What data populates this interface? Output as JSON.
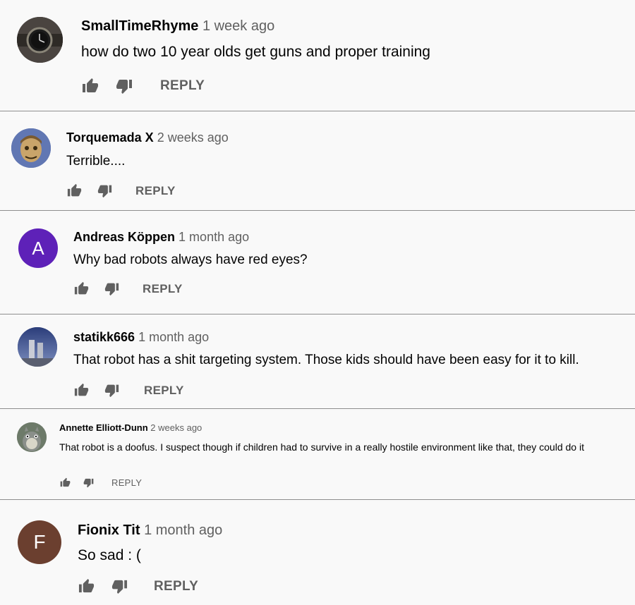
{
  "comments": [
    {
      "author": "SmallTimeRhyme",
      "time": "1 week ago",
      "text": "how do two 10 year olds get guns and proper training",
      "reply_label": "REPLY",
      "avatar": {
        "type": "image",
        "icon": "wristwatch-avatar",
        "bg": "#3a3530"
      }
    },
    {
      "author": "Torquemada X",
      "time": "2 weeks ago",
      "text": "Terrible....",
      "reply_label": "REPLY",
      "avatar": {
        "type": "image",
        "icon": "zombie-mascot-avatar",
        "bg": "#5a6ea8"
      }
    },
    {
      "author": "Andreas Köppen",
      "time": "1 month ago",
      "text": "Why bad robots always have red eyes?",
      "reply_label": "REPLY",
      "avatar": {
        "type": "letter",
        "letter": "A",
        "bg": "#5e21b8"
      }
    },
    {
      "author": "statikk666",
      "time": "1 month ago",
      "text": "That robot has a shit targeting system. Those kids should have been easy for it to kill.",
      "reply_label": "REPLY",
      "avatar": {
        "type": "image",
        "icon": "twin-towers-avatar",
        "bg": "#3d4f86"
      }
    },
    {
      "author": "Annette Elliott-Dunn",
      "time": "2 weeks ago",
      "text": "That robot is a doofus. I suspect though if children had to survive in a really hostile environment like that, they could do it",
      "reply_label": "REPLY",
      "avatar": {
        "type": "image",
        "icon": "totoro-avatar",
        "bg": "#5f6b5e"
      }
    },
    {
      "author": "Fionix Tit",
      "time": "1 month ago",
      "text": "So sad : (",
      "reply_label": "REPLY",
      "avatar": {
        "type": "letter",
        "letter": "F",
        "bg": "#6b3f2f"
      }
    }
  ],
  "colors": {
    "background": "#f9f9f9",
    "divider": "#8e8e8e",
    "secondary_text": "#606060",
    "icon": "#606060"
  }
}
